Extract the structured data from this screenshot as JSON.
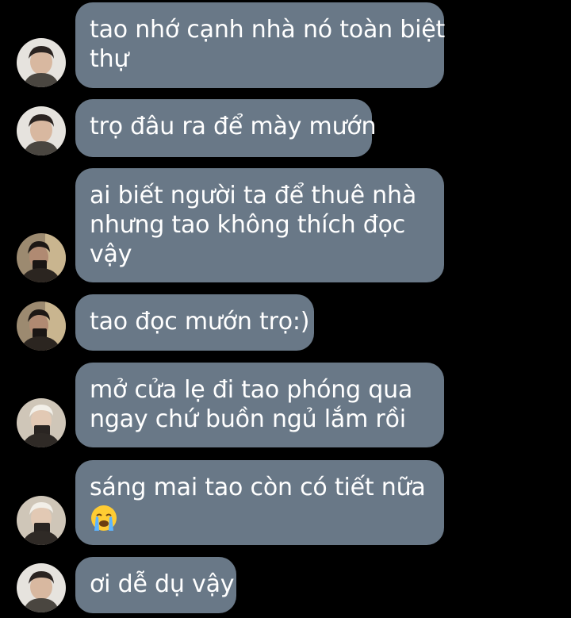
{
  "chat": {
    "messages": [
      {
        "sender_avatar": "avatar-a",
        "lines": [
          "tao nhớ cạnh nhà nó toàn biệt",
          "thự"
        ]
      },
      {
        "sender_avatar": "avatar-a",
        "lines": [
          "trọ đâu ra để mày mướn"
        ]
      },
      {
        "sender_avatar": "avatar-b",
        "lines": [
          "ai biết người ta để thuê nhà",
          "nhưng tao không thích đọc",
          "vậy"
        ]
      },
      {
        "sender_avatar": "avatar-b",
        "lines": [
          "tao đọc mướn trọ:)"
        ]
      },
      {
        "sender_avatar": "avatar-c",
        "lines": [
          "mở cửa lẹ đi tao phóng qua",
          "ngay chứ buồn ngủ lắm rồi"
        ]
      },
      {
        "sender_avatar": "avatar-c",
        "lines": [
          "sáng mai tao còn có tiết nữa"
        ],
        "emoji": "loudly-crying-face"
      },
      {
        "sender_avatar": "avatar-a",
        "lines": [
          "ơi dễ dụ vậy"
        ]
      }
    ]
  },
  "colors": {
    "background": "#000000",
    "bubble": "#697887",
    "text": "#ffffff"
  }
}
